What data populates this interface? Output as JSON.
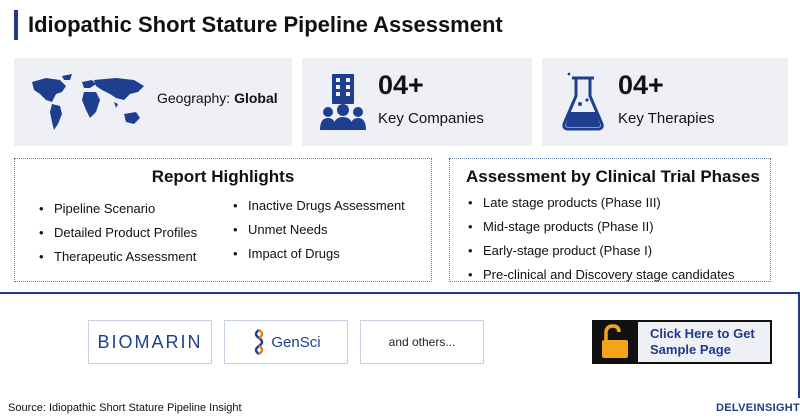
{
  "header": {
    "title": "Idiopathic Short Stature Pipeline Assessment"
  },
  "geography": {
    "label": "Geography:",
    "value": "Global"
  },
  "companies": {
    "count": "04+",
    "label": "Key Companies"
  },
  "therapies": {
    "count": "04+",
    "label": "Key Therapies"
  },
  "highlights": {
    "title": "Report Highlights",
    "col1": [
      "Pipeline Scenario",
      "Detailed Product Profiles",
      "Therapeutic Assessment"
    ],
    "col2": [
      "Inactive Drugs Assessment",
      "Unmet Needs",
      "Impact of Drugs"
    ]
  },
  "phases": {
    "title": "Assessment by Clinical Trial Phases",
    "items": [
      "Late stage products (Phase III)",
      "Mid-stage products (Phase II)",
      "Early-stage product (Phase I)",
      "Pre-clinical and Discovery stage candidates"
    ]
  },
  "logos": {
    "biomarin": "BIOMARIN",
    "gensci": "GenSci",
    "others": "and others..."
  },
  "cta": {
    "line1": "Click Here to Get",
    "line2": "Sample Page"
  },
  "footer": {
    "source": "Source: Idiopathic Short Stature Pipeline Insight",
    "brand": "DELVEINSIGHT"
  },
  "colors": {
    "accent": "#1f3a8a",
    "card_bg": "#eef0f6",
    "lock": "#f2a516"
  }
}
